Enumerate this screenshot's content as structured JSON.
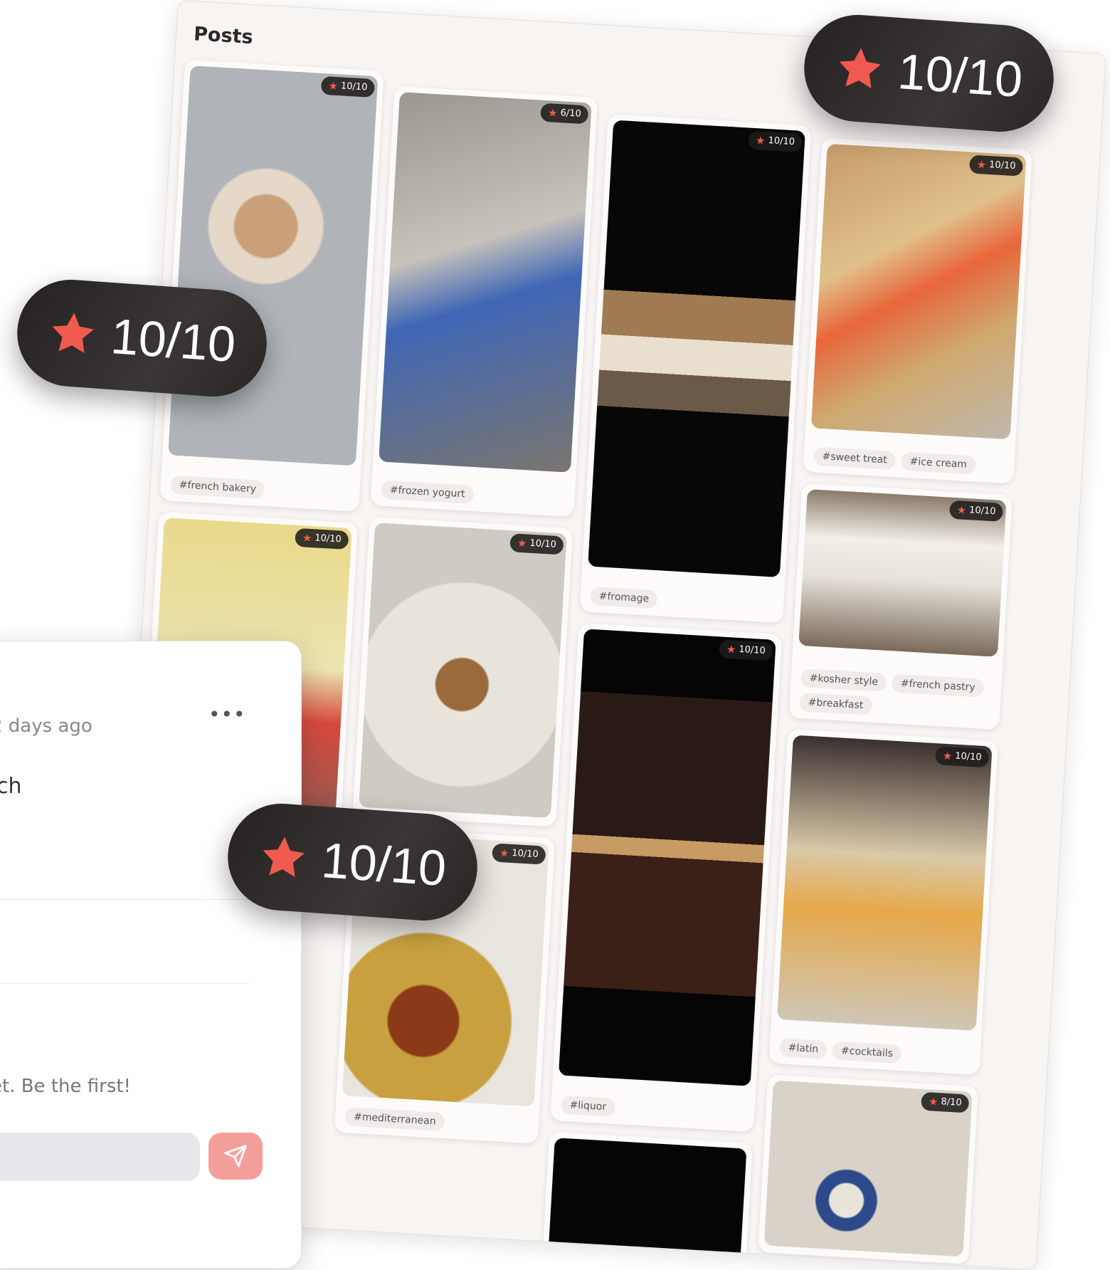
{
  "board": {
    "title": "Posts",
    "posts": [
      {
        "rating": "10/10",
        "tags": [
          "#french bakery"
        ]
      },
      {
        "rating": "6/10",
        "tags": [
          "#frozen yogurt"
        ]
      },
      {
        "rating": "10/10",
        "tags": [
          "#fromage"
        ]
      },
      {
        "rating": "10/10",
        "tags": [
          "#sweet treat",
          "#ice cream"
        ]
      },
      {
        "rating": "10/10",
        "tags": []
      },
      {
        "rating": "10/10",
        "tags": []
      },
      {
        "rating": "10/10",
        "tags": [
          "#liquor"
        ]
      },
      {
        "rating": "10/10",
        "tags": [
          "#kosher style",
          "#french pastry",
          "#breakfast"
        ]
      },
      {
        "rating": "10/10",
        "tags": [
          "#mediterranean"
        ]
      },
      {
        "rating": "10/10",
        "tags": [
          "#latin",
          "#cocktails"
        ]
      },
      {
        "rating": "8/10",
        "tags": []
      }
    ]
  },
  "panel": {
    "time": "2 days ago",
    "user_fragment": "ch",
    "more_label": "•••",
    "empty_comments": "et. Be the first!",
    "comment_placeholder": ""
  },
  "pills": {
    "rating": "10/10"
  },
  "colors": {
    "star": "#f05a4f",
    "pill_bg": "#2b2727",
    "send_button": "#f59f9b"
  }
}
